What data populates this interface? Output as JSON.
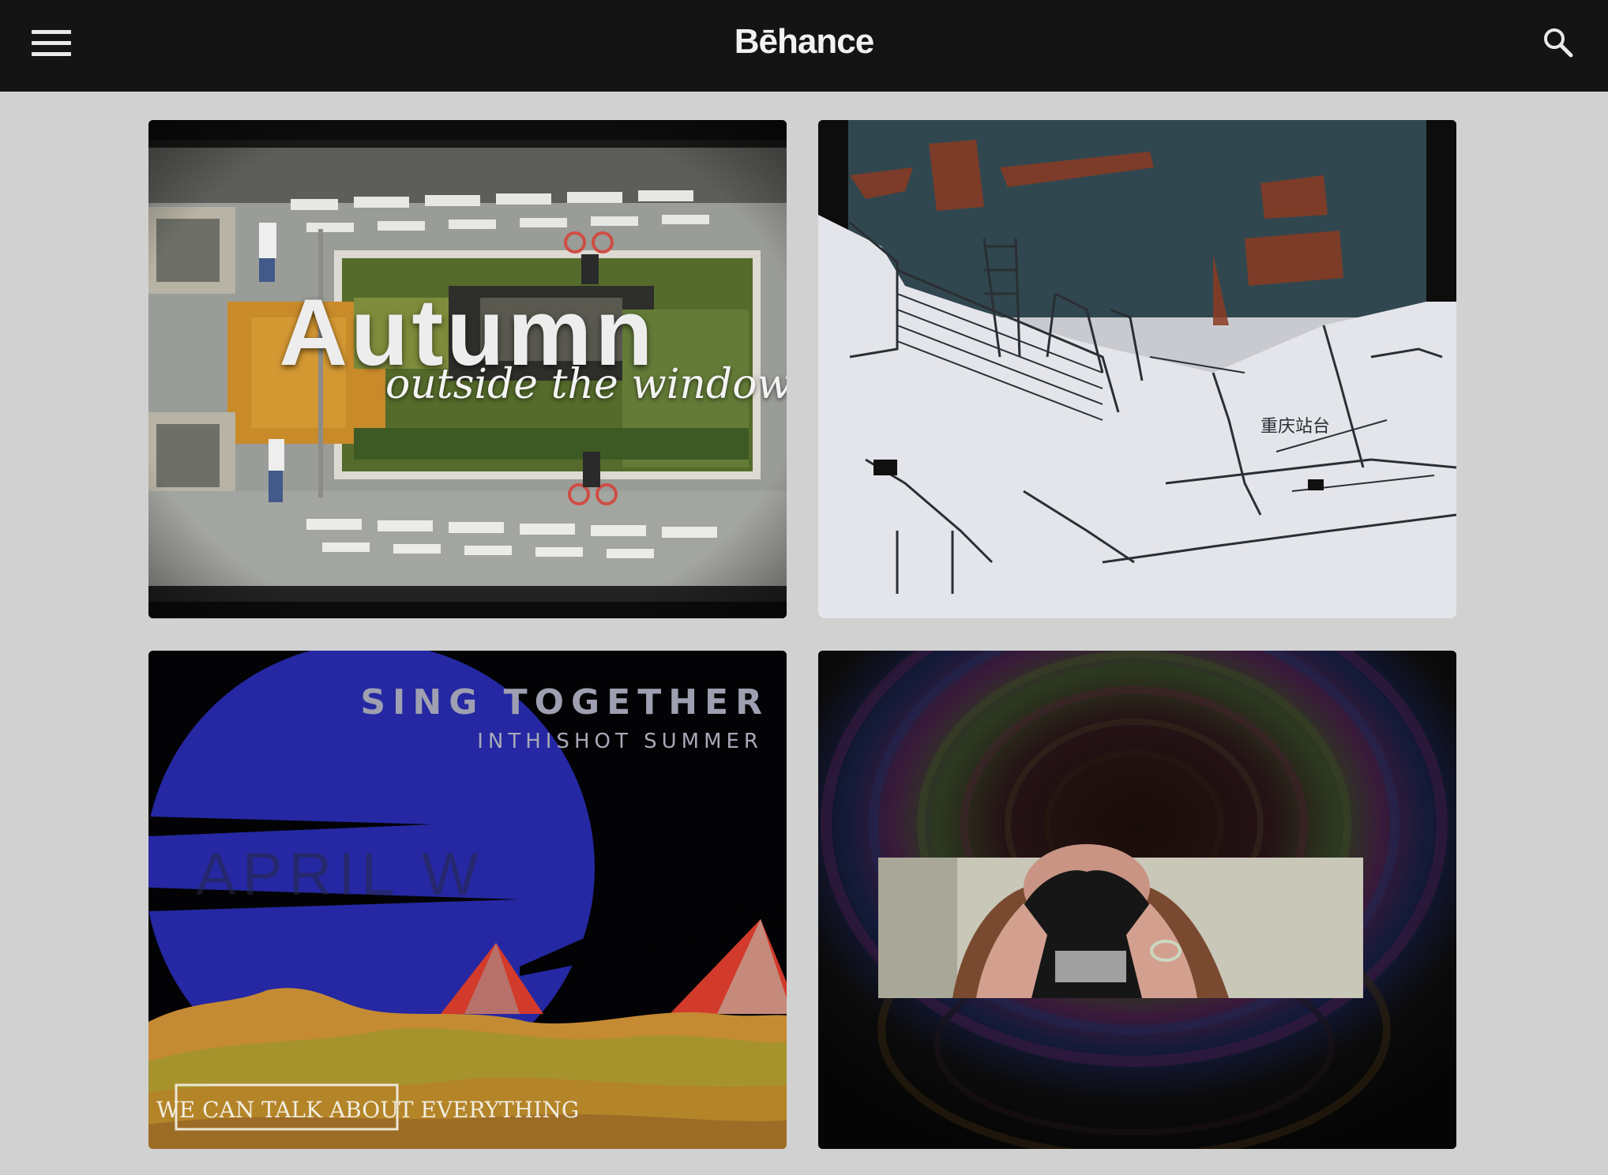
{
  "header": {
    "logo_text": "Bēhance",
    "menu_icon": "hamburger-menu-icon",
    "search_icon": "search-icon"
  },
  "projects": [
    {
      "title_text": "Autumn",
      "subtitle_text": "outside the window"
    },
    {
      "sign_text": "重庆站台"
    },
    {
      "title_text": "SING TOGETHER",
      "subtitle_text": "INTHISHOT SUMMER",
      "faded_text": "APRIL W",
      "caption_text": "WE CAN TALK ABOUT EVERYTHING"
    },
    {}
  ],
  "colors": {
    "header_bg": "#141414",
    "page_bg": "#d1d1d1"
  }
}
